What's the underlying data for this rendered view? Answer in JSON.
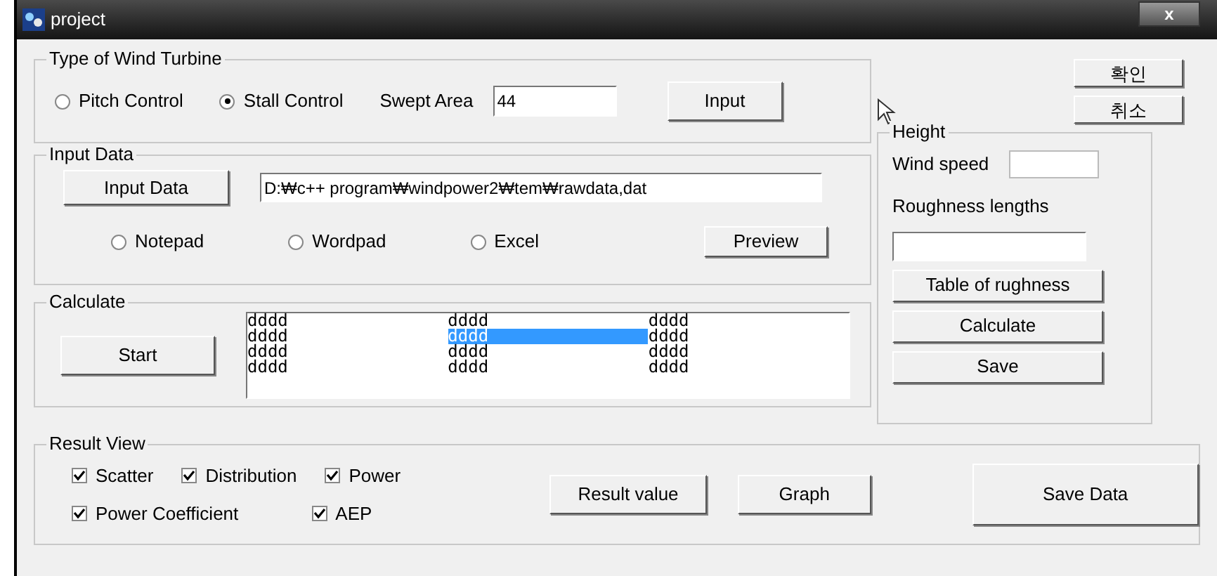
{
  "window": {
    "title": "project",
    "close": "x"
  },
  "turbine": {
    "title": "Type of Wind Turbine",
    "options": [
      {
        "label": "Pitch Control",
        "selected": false
      },
      {
        "label": "Stall Control",
        "selected": true
      }
    ],
    "area_label": "Swept Area",
    "area_value": "44",
    "button": "Input"
  },
  "input_data": {
    "title": "Input Data",
    "button": "Input Data",
    "path": "D:₩c++ program₩windpower2₩tem₩rawdata,dat",
    "options": [
      {
        "label": "Notepad",
        "selected": false
      },
      {
        "label": "Wordpad",
        "selected": false
      },
      {
        "label": "Excel",
        "selected": false
      }
    ],
    "preview": "Preview"
  },
  "calculate": {
    "title": "Calculate",
    "button": "Start",
    "rows": [
      [
        {
          "text": "dddd",
          "selected": false
        },
        {
          "text": "dddd",
          "selected": false
        },
        {
          "text": "dddd",
          "selected": false
        }
      ],
      [
        {
          "text": "dddd",
          "selected": false
        },
        {
          "text": "dddd",
          "selected": true
        },
        {
          "text": "dddd",
          "selected": false
        }
      ],
      [
        {
          "text": "dddd",
          "selected": false
        },
        {
          "text": "dddd",
          "selected": false
        },
        {
          "text": "dddd",
          "selected": false
        }
      ],
      [
        {
          "text": "dddd",
          "selected": false
        },
        {
          "text": "dddd",
          "selected": false
        },
        {
          "text": "dddd",
          "selected": false
        }
      ]
    ]
  },
  "dialog_buttons": [
    "확인",
    "취소"
  ],
  "height": {
    "title": "Height",
    "wind_speed_label": "Wind speed",
    "roughness_label": "Roughness lengths",
    "buttons": [
      "Table of rughness",
      "Calculate",
      "Save"
    ]
  },
  "result_view": {
    "title": "Result View",
    "checks": [
      {
        "label": "Scatter",
        "checked": true
      },
      {
        "label": "Distribution",
        "checked": true
      },
      {
        "label": "Power",
        "checked": true
      },
      {
        "label": "Power Coefficient",
        "checked": true
      },
      {
        "label": "AEP",
        "checked": true
      }
    ],
    "buttons": [
      "Result value",
      "Graph"
    ],
    "save": "Save Data"
  }
}
